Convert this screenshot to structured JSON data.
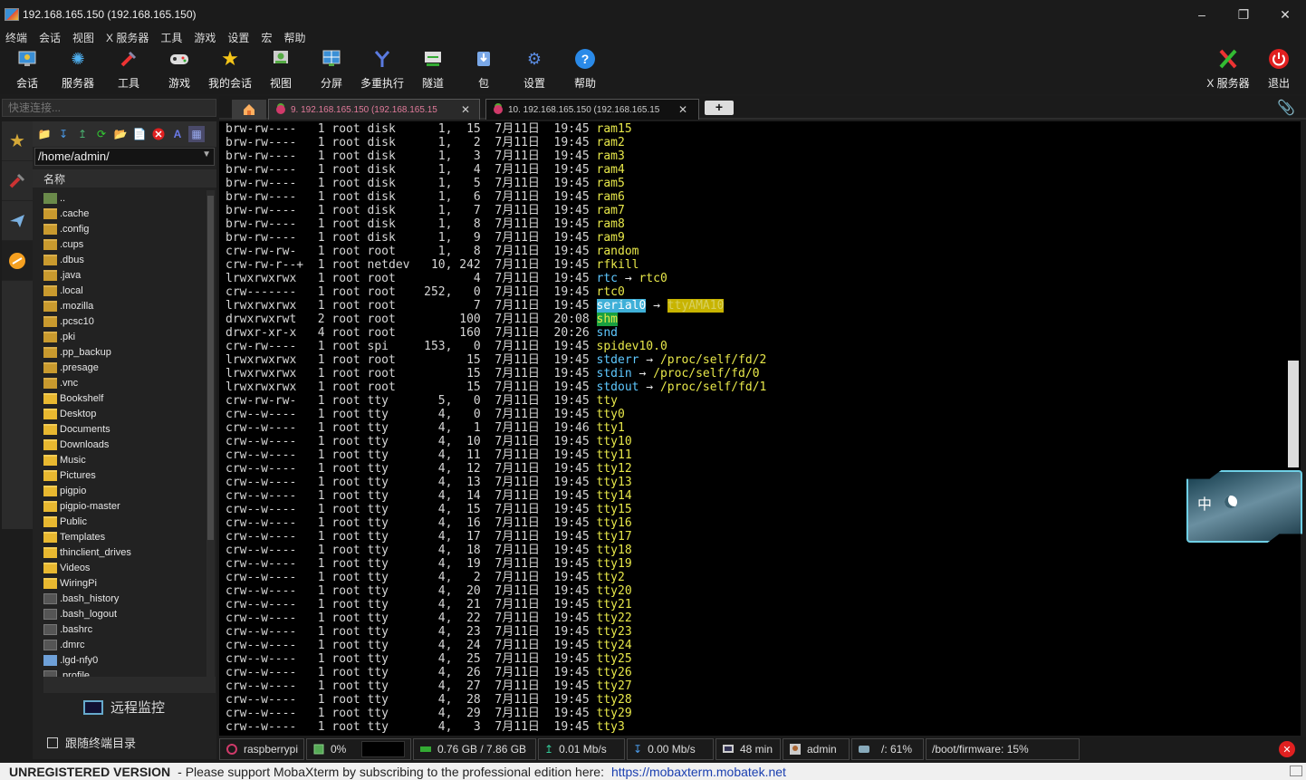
{
  "window": {
    "title": "192.168.165.150 (192.168.165.150)"
  },
  "menu": [
    "终端",
    "会话",
    "视图",
    "X 服务器",
    "工具",
    "游戏",
    "设置",
    "宏",
    "帮助"
  ],
  "toolbar": {
    "left": [
      {
        "label": "会话",
        "icon": "session-icon"
      },
      {
        "label": "服务器",
        "icon": "servers-icon"
      },
      {
        "label": "工具",
        "icon": "tools-icon"
      },
      {
        "label": "游戏",
        "icon": "games-icon"
      },
      {
        "label": "我的会话",
        "icon": "star-icon"
      },
      {
        "label": "视图",
        "icon": "view-icon"
      },
      {
        "label": "分屏",
        "icon": "split-icon"
      },
      {
        "label": "多重执行",
        "icon": "multiexec-icon"
      },
      {
        "label": "隧道",
        "icon": "tunnel-icon"
      },
      {
        "label": "包",
        "icon": "packages-icon"
      },
      {
        "label": "设置",
        "icon": "settings-icon"
      },
      {
        "label": "帮助",
        "icon": "help-icon"
      }
    ],
    "xserver_label": "X 服务器",
    "exit_label": "退出"
  },
  "quick_connect": {
    "placeholder": "快速连接..."
  },
  "tabs": [
    {
      "label": "9. 192.168.165.150 (192.168.165.15",
      "active": false
    },
    {
      "label": "10. 192.168.165.150 (192.168.165.15",
      "active": true
    }
  ],
  "sidebar": {
    "path": "/home/admin/",
    "column_name": "名称",
    "files": [
      {
        "name": "..",
        "type": "up"
      },
      {
        "name": ".cache",
        "type": "folder"
      },
      {
        "name": ".config",
        "type": "folder"
      },
      {
        "name": ".cups",
        "type": "folder"
      },
      {
        "name": ".dbus",
        "type": "folder"
      },
      {
        "name": ".java",
        "type": "folder"
      },
      {
        "name": ".local",
        "type": "folder"
      },
      {
        "name": ".mozilla",
        "type": "folder"
      },
      {
        "name": ".pcsc10",
        "type": "folder"
      },
      {
        "name": ".pki",
        "type": "folder"
      },
      {
        "name": ".pp_backup",
        "type": "folder"
      },
      {
        "name": ".presage",
        "type": "folder"
      },
      {
        "name": ".vnc",
        "type": "folder"
      },
      {
        "name": "Bookshelf",
        "type": "folder-bright"
      },
      {
        "name": "Desktop",
        "type": "folder-bright"
      },
      {
        "name": "Documents",
        "type": "folder-bright"
      },
      {
        "name": "Downloads",
        "type": "folder-bright"
      },
      {
        "name": "Music",
        "type": "folder-bright"
      },
      {
        "name": "Pictures",
        "type": "folder-bright"
      },
      {
        "name": "pigpio",
        "type": "folder-bright"
      },
      {
        "name": "pigpio-master",
        "type": "folder-bright"
      },
      {
        "name": "Public",
        "type": "folder-bright"
      },
      {
        "name": "Templates",
        "type": "folder-bright"
      },
      {
        "name": "thinclient_drives",
        "type": "folder-bright"
      },
      {
        "name": "Videos",
        "type": "folder-bright"
      },
      {
        "name": "WiringPi",
        "type": "folder-bright"
      },
      {
        "name": ".bash_history",
        "type": "file"
      },
      {
        "name": ".bash_logout",
        "type": "file"
      },
      {
        "name": ".bashrc",
        "type": "file"
      },
      {
        "name": ".dmrc",
        "type": "file"
      },
      {
        "name": ".lgd-nfy0",
        "type": "link"
      },
      {
        "name": ".profile",
        "type": "file"
      }
    ],
    "remote_monitor": "远程监控",
    "follow_terminal": "跟随终端目录"
  },
  "terminal": {
    "lines": [
      {
        "p": "brw-rw----   1 root disk      1,  15  7月11日  19:45 ",
        "n": "ram15",
        "c": "y"
      },
      {
        "p": "brw-rw----   1 root disk      1,   2  7月11日  19:45 ",
        "n": "ram2",
        "c": "y"
      },
      {
        "p": "brw-rw----   1 root disk      1,   3  7月11日  19:45 ",
        "n": "ram3",
        "c": "y"
      },
      {
        "p": "brw-rw----   1 root disk      1,   4  7月11日  19:45 ",
        "n": "ram4",
        "c": "y"
      },
      {
        "p": "brw-rw----   1 root disk      1,   5  7月11日  19:45 ",
        "n": "ram5",
        "c": "y"
      },
      {
        "p": "brw-rw----   1 root disk      1,   6  7月11日  19:45 ",
        "n": "ram6",
        "c": "y"
      },
      {
        "p": "brw-rw----   1 root disk      1,   7  7月11日  19:45 ",
        "n": "ram7",
        "c": "y"
      },
      {
        "p": "brw-rw----   1 root disk      1,   8  7月11日  19:45 ",
        "n": "ram8",
        "c": "y"
      },
      {
        "p": "brw-rw----   1 root disk      1,   9  7月11日  19:45 ",
        "n": "ram9",
        "c": "y"
      },
      {
        "p": "crw-rw-rw-   1 root root      1,   8  7月11日  19:45 ",
        "n": "random",
        "c": "y"
      },
      {
        "p": "crw-rw-r--+  1 root netdev   10, 242  7月11日  19:45 ",
        "n": "rfkill",
        "c": "y"
      },
      {
        "p": "lrwxrwxrwx   1 root root           4  7月11日  19:45 ",
        "n": "rtc",
        "c": "c",
        "arrow": " → ",
        "target": "rtc0",
        "tc": "y"
      },
      {
        "p": "crw-------   1 root root    252,   0  7月11日  19:45 ",
        "n": "rtc0",
        "c": "y"
      },
      {
        "p": "lrwxrwxrwx   1 root root           7  7月11日  19:45 ",
        "n": "serial0",
        "c": "hl1",
        "arrow": " → ",
        "target": "ttyAMA10",
        "tc": "hl2"
      },
      {
        "p": "drwxrwxrwt   2 root root         100  7月11日  20:08 ",
        "n": "shm",
        "c": "hl3"
      },
      {
        "p": "drwxr-xr-x   4 root root         160  7月11日  20:26 ",
        "n": "snd",
        "c": "c"
      },
      {
        "p": "crw-rw----   1 root spi     153,   0  7月11日  19:45 ",
        "n": "spidev10.0",
        "c": "y"
      },
      {
        "p": "lrwxrwxrwx   1 root root          15  7月11日  19:45 ",
        "n": "stderr",
        "c": "c",
        "arrow": " → ",
        "target": "/proc/self/fd/2",
        "tc": "y"
      },
      {
        "p": "lrwxrwxrwx   1 root root          15  7月11日  19:45 ",
        "n": "stdin",
        "c": "c",
        "arrow": " → ",
        "target": "/proc/self/fd/0",
        "tc": "y"
      },
      {
        "p": "lrwxrwxrwx   1 root root          15  7月11日  19:45 ",
        "n": "stdout",
        "c": "c",
        "arrow": " → ",
        "target": "/proc/self/fd/1",
        "tc": "y"
      },
      {
        "p": "crw-rw-rw-   1 root tty       5,   0  7月11日  19:45 ",
        "n": "tty",
        "c": "y"
      },
      {
        "p": "crw--w----   1 root tty       4,   0  7月11日  19:45 ",
        "n": "tty0",
        "c": "y"
      },
      {
        "p": "crw--w----   1 root tty       4,   1  7月11日  19:46 ",
        "n": "tty1",
        "c": "y"
      },
      {
        "p": "crw--w----   1 root tty       4,  10  7月11日  19:45 ",
        "n": "tty10",
        "c": "y"
      },
      {
        "p": "crw--w----   1 root tty       4,  11  7月11日  19:45 ",
        "n": "tty11",
        "c": "y"
      },
      {
        "p": "crw--w----   1 root tty       4,  12  7月11日  19:45 ",
        "n": "tty12",
        "c": "y"
      },
      {
        "p": "crw--w----   1 root tty       4,  13  7月11日  19:45 ",
        "n": "tty13",
        "c": "y"
      },
      {
        "p": "crw--w----   1 root tty       4,  14  7月11日  19:45 ",
        "n": "tty14",
        "c": "y"
      },
      {
        "p": "crw--w----   1 root tty       4,  15  7月11日  19:45 ",
        "n": "tty15",
        "c": "y"
      },
      {
        "p": "crw--w----   1 root tty       4,  16  7月11日  19:45 ",
        "n": "tty16",
        "c": "y"
      },
      {
        "p": "crw--w----   1 root tty       4,  17  7月11日  19:45 ",
        "n": "tty17",
        "c": "y"
      },
      {
        "p": "crw--w----   1 root tty       4,  18  7月11日  19:45 ",
        "n": "tty18",
        "c": "y"
      },
      {
        "p": "crw--w----   1 root tty       4,  19  7月11日  19:45 ",
        "n": "tty19",
        "c": "y"
      },
      {
        "p": "crw--w----   1 root tty       4,   2  7月11日  19:45 ",
        "n": "tty2",
        "c": "y"
      },
      {
        "p": "crw--w----   1 root tty       4,  20  7月11日  19:45 ",
        "n": "tty20",
        "c": "y"
      },
      {
        "p": "crw--w----   1 root tty       4,  21  7月11日  19:45 ",
        "n": "tty21",
        "c": "y"
      },
      {
        "p": "crw--w----   1 root tty       4,  22  7月11日  19:45 ",
        "n": "tty22",
        "c": "y"
      },
      {
        "p": "crw--w----   1 root tty       4,  23  7月11日  19:45 ",
        "n": "tty23",
        "c": "y"
      },
      {
        "p": "crw--w----   1 root tty       4,  24  7月11日  19:45 ",
        "n": "tty24",
        "c": "y"
      },
      {
        "p": "crw--w----   1 root tty       4,  25  7月11日  19:45 ",
        "n": "tty25",
        "c": "y"
      },
      {
        "p": "crw--w----   1 root tty       4,  26  7月11日  19:45 ",
        "n": "tty26",
        "c": "y"
      },
      {
        "p": "crw--w----   1 root tty       4,  27  7月11日  19:45 ",
        "n": "tty27",
        "c": "y"
      },
      {
        "p": "crw--w----   1 root tty       4,  28  7月11日  19:45 ",
        "n": "tty28",
        "c": "y"
      },
      {
        "p": "crw--w----   1 root tty       4,  29  7月11日  19:45 ",
        "n": "tty29",
        "c": "y"
      },
      {
        "p": "crw--w----   1 root tty       4,   3  7月11日  19:45 ",
        "n": "tty3",
        "c": "y"
      }
    ]
  },
  "widget": {
    "text": "中"
  },
  "status": {
    "host": "raspberrypi",
    "cpu": "0%",
    "memory": "0.76 GB / 7.86 GB",
    "upload": "0.01 Mb/s",
    "download": "0.00 Mb/s",
    "uptime": "48 min",
    "user": "admin",
    "disk_root": "/: 61%",
    "disk_boot": "/boot/firmware: 15%"
  },
  "footer": {
    "unregistered": "UNREGISTERED VERSION",
    "message": "-  Please support MobaXterm by subscribing to the professional edition here:",
    "link": "https://mobaxterm.mobatek.net"
  },
  "colors": {
    "accent_tab_text": "#e07a9a",
    "terminal_yellow": "#e8e84a",
    "terminal_cyan": "#5ec8ff"
  }
}
